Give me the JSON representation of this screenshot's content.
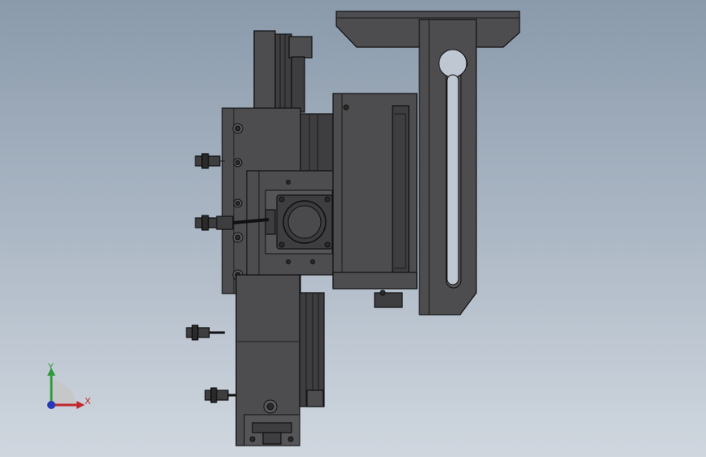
{
  "viewport": {
    "background_top": "#8a9aab",
    "background_bottom": "#d0d7df",
    "model_color": "#4d4d4f"
  },
  "triad": {
    "x_label": "X",
    "y_label": "Y",
    "x_color": "#c0282d",
    "y_color": "#2e9a3a",
    "z_color": "#2638b8"
  }
}
